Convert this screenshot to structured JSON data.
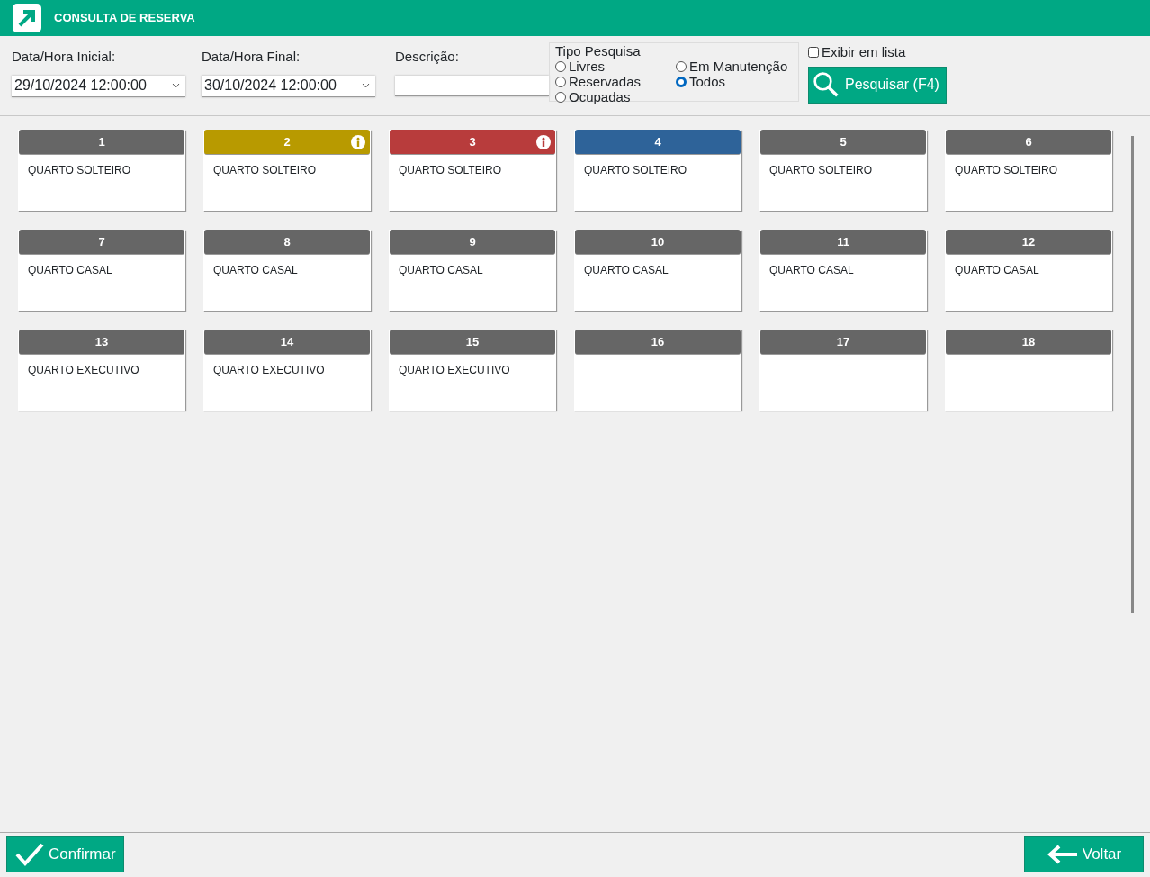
{
  "window": {
    "title": "CONSULTA DE RESERVA"
  },
  "filters": {
    "start_label": "Data/Hora Inicial:",
    "start_value": "29/10/2024 12:00:00",
    "end_label": "Data/Hora Final:",
    "end_value": "30/10/2024 12:00:00",
    "description_label": "Descrição:"
  },
  "search_type": {
    "title": "Tipo Pesquisa",
    "options": [
      {
        "label": "Livres",
        "selected": false
      },
      {
        "label": "Reservadas",
        "selected": false
      },
      {
        "label": "Ocupadas",
        "selected": false
      },
      {
        "label": "Em Manutenção",
        "selected": false
      },
      {
        "label": "Todos",
        "selected": true
      }
    ]
  },
  "list_view": {
    "label": "Exibir em lista",
    "checked": false
  },
  "search_button": "Pesquisar (F4)",
  "rooms": [
    {
      "number": "1",
      "type": "QUARTO SOLTEIRO",
      "color": "#666666",
      "info": false
    },
    {
      "number": "2",
      "type": "QUARTO SOLTEIRO",
      "color": "#b89a00",
      "info": true
    },
    {
      "number": "3",
      "type": "QUARTO SOLTEIRO",
      "color": "#b83c3c",
      "info": true
    },
    {
      "number": "4",
      "type": "QUARTO SOLTEIRO",
      "color": "#2e6399",
      "info": false
    },
    {
      "number": "5",
      "type": "QUARTO SOLTEIRO",
      "color": "#666666",
      "info": false
    },
    {
      "number": "6",
      "type": "QUARTO SOLTEIRO",
      "color": "#666666",
      "info": false
    },
    {
      "number": "7",
      "type": "QUARTO CASAL",
      "color": "#666666",
      "info": false
    },
    {
      "number": "8",
      "type": "QUARTO CASAL",
      "color": "#666666",
      "info": false
    },
    {
      "number": "9",
      "type": "QUARTO CASAL",
      "color": "#666666",
      "info": false
    },
    {
      "number": "10",
      "type": "QUARTO CASAL",
      "color": "#666666",
      "info": false
    },
    {
      "number": "11",
      "type": "QUARTO CASAL",
      "color": "#666666",
      "info": false
    },
    {
      "number": "12",
      "type": "QUARTO CASAL",
      "color": "#666666",
      "info": false
    },
    {
      "number": "13",
      "type": "QUARTO EXECUTIVO",
      "color": "#666666",
      "info": false
    },
    {
      "number": "14",
      "type": "QUARTO EXECUTIVO",
      "color": "#666666",
      "info": false
    },
    {
      "number": "15",
      "type": "QUARTO EXECUTIVO",
      "color": "#666666",
      "info": false
    },
    {
      "number": "16",
      "color": "#666666",
      "info": false
    },
    {
      "number": "17",
      "color": "#666666",
      "info": false
    },
    {
      "number": "18",
      "color": "#666666",
      "info": false
    }
  ],
  "footer": {
    "confirm": "Confirmar",
    "back": "Voltar"
  }
}
